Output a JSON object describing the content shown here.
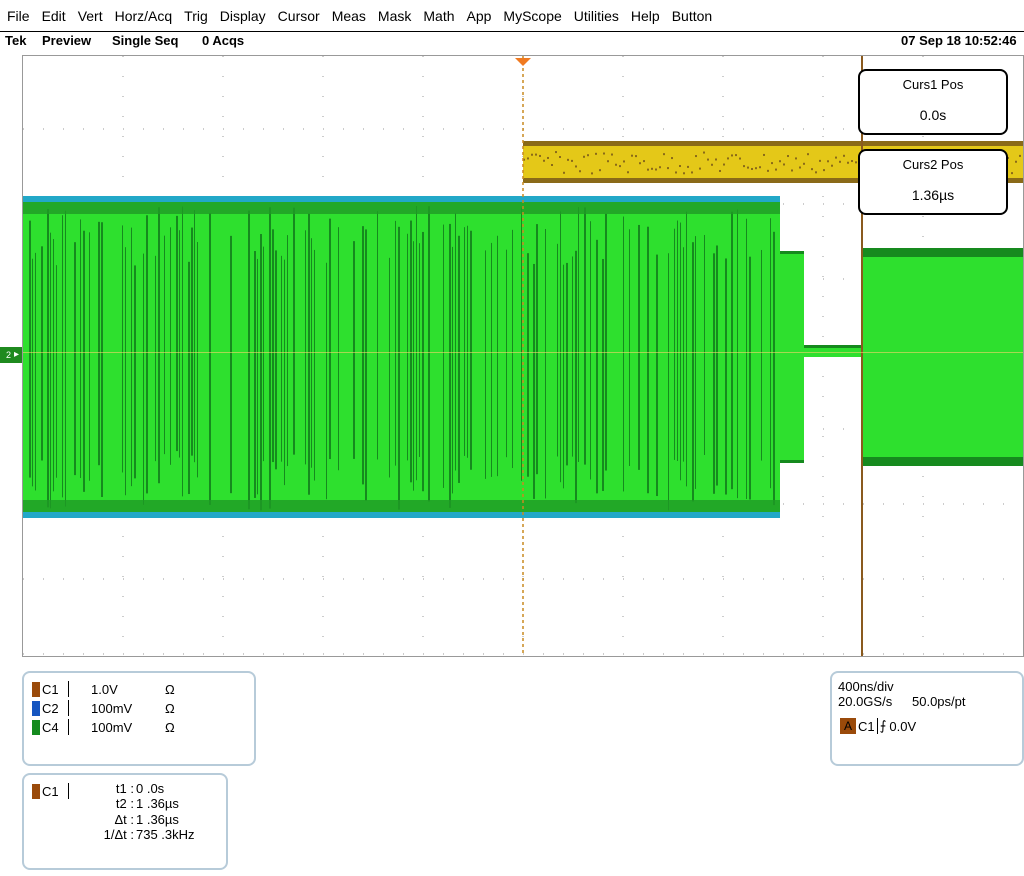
{
  "menu": [
    "File",
    "Edit",
    "Vert",
    "Horz/Acq",
    "Trig",
    "Display",
    "Cursor",
    "Meas",
    "Mask",
    "Math",
    "App",
    "MyScope",
    "Utilities",
    "Help",
    "Button"
  ],
  "status": {
    "brand": "Tek",
    "mode": "Preview",
    "seq": "Single Seq",
    "acqs": "0 Acqs",
    "datetime": "07 Sep 18 10:52:46"
  },
  "channel_marker": "2",
  "cursors": {
    "c1": {
      "title": "Curs1 Pos",
      "value": "0.0s"
    },
    "c2": {
      "title": "Curs2 Pos",
      "value": "1.36µs"
    }
  },
  "channels": [
    {
      "name": "C1",
      "scale": "1.0V",
      "coupling": "Ω",
      "color": "#9a4a0a"
    },
    {
      "name": "C2",
      "scale": "100mV",
      "coupling": "Ω",
      "color": "#1555c0"
    },
    {
      "name": "C4",
      "scale": "100mV",
      "coupling": "Ω",
      "color": "#148a1e"
    }
  ],
  "timebase": {
    "scale": "400ns/div",
    "rate": "20.0GS/s",
    "resolution": "50.0ps/pt",
    "trigger_label": "A",
    "trigger_source": "C1",
    "trigger_slope": "⨍",
    "trigger_level": "0.0V"
  },
  "measurements": {
    "source": "C1",
    "rows": [
      {
        "label": "t1 :",
        "value": "0 .0s"
      },
      {
        "label": "t2 :",
        "value": "1 .36µs"
      },
      {
        "label": "Δt :",
        "value": "1 .36µs"
      },
      {
        "label": "1/Δt :",
        "value": "735 .3kHz"
      }
    ]
  },
  "colors": {
    "ch1_trace": "#e2c817",
    "ch4_trace_light": "#2ee02e",
    "ch4_trace_dark": "#168a1e",
    "ch2_trace": "#22a8c8",
    "cursor_line": "#8a5a1e"
  }
}
